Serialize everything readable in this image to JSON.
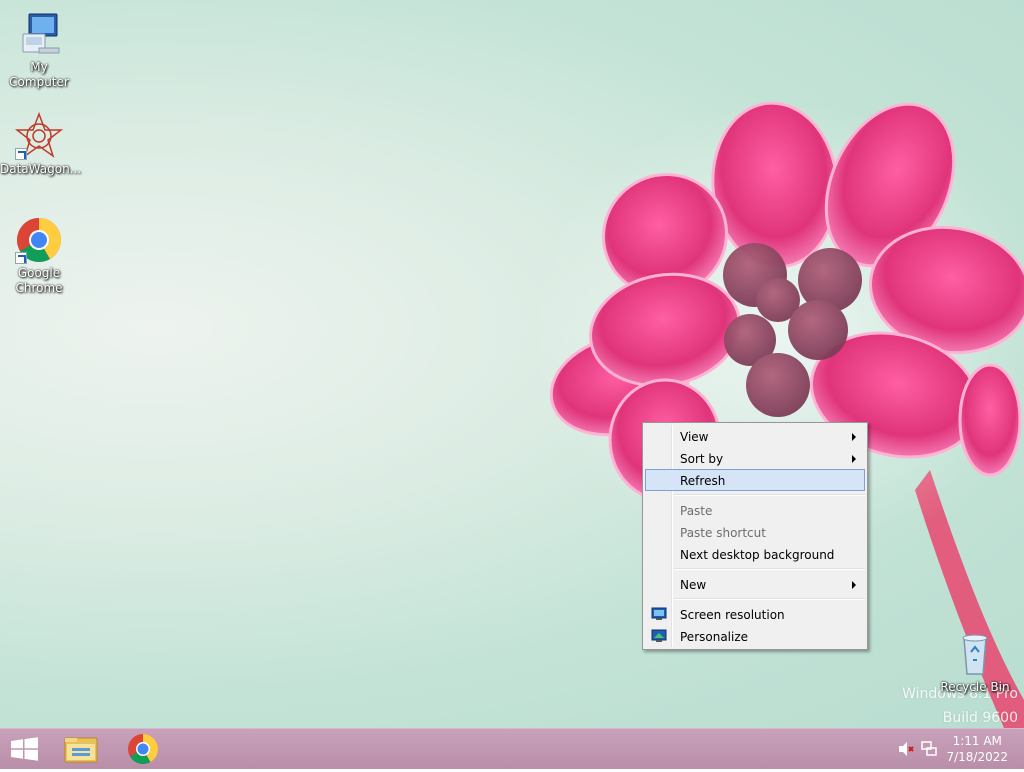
{
  "desktop": {
    "icons": [
      {
        "label": "My Computer",
        "icon": "computer-icon"
      },
      {
        "label": "DataWagon...",
        "icon": "datawagon-icon"
      },
      {
        "label": "Google Chrome",
        "label_line1": "Google",
        "label_line2": "Chrome",
        "icon": "chrome-icon"
      },
      {
        "label": "Recycle Bin",
        "icon": "recycle-bin-icon"
      }
    ],
    "watermark": {
      "line1": "Windows 8.1 Pro",
      "line2": "Build 9600"
    }
  },
  "context_menu": {
    "items": [
      {
        "label": "View",
        "submenu": true,
        "enabled": true
      },
      {
        "label": "Sort by",
        "submenu": true,
        "enabled": true
      },
      {
        "label": "Refresh",
        "submenu": false,
        "enabled": true,
        "highlighted": true
      },
      {
        "label": "Paste",
        "submenu": false,
        "enabled": false
      },
      {
        "label": "Paste shortcut",
        "submenu": false,
        "enabled": false
      },
      {
        "label": "Next desktop background",
        "submenu": false,
        "enabled": true
      },
      {
        "label": "New",
        "submenu": true,
        "enabled": true
      },
      {
        "label": "Screen resolution",
        "submenu": false,
        "enabled": true,
        "icon": "screen-resolution-icon"
      },
      {
        "label": "Personalize",
        "submenu": false,
        "enabled": true,
        "icon": "personalize-icon"
      }
    ]
  },
  "taskbar": {
    "pinned": [
      {
        "name": "start-button",
        "icon": "windows-logo-icon"
      },
      {
        "name": "file-explorer",
        "icon": "folder-icon"
      },
      {
        "name": "google-chrome",
        "icon": "chrome-icon"
      }
    ],
    "tray": {
      "volume_icon": "speaker-muted-icon",
      "network_icon": "network-icon"
    },
    "clock": {
      "time": "1:11 AM",
      "date": "7/18/2022"
    }
  },
  "colors": {
    "taskbar": "#c29ab4",
    "menu_highlight": "#d5e5f7",
    "flower": "#e0347a"
  }
}
